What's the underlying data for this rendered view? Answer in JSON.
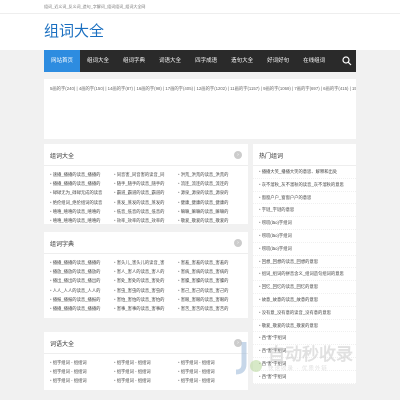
{
  "topline": "组词_近义词_反义词_造句_字解词_组词组词_组词大全网",
  "site_title": "组词大全",
  "nav": {
    "items": [
      "网站首页",
      "组词大全",
      "组词字典",
      "词语大全",
      "四字成语",
      "造句大全",
      "好词好句",
      "在线组词"
    ],
    "active_index": 0
  },
  "counts": [
    "5画的字(240)",
    "4画的字(150)",
    "14画的字(87)",
    "16画的字(98)",
    "17画的字(405)",
    "12画的字(1202)",
    "11画的字(1157)",
    "9画的字(1069)",
    "7画的字(697)",
    "6画的字(415)",
    "15画的字(525)",
    "13画的字(1024)",
    "10画的字(1129)",
    "8画的字(915)",
    "拼音(376)",
    "部首(1724)",
    "近义词(716)",
    "反义词(410)",
    "造句(767)",
    "词语(649)",
    "成语(3529)",
    "诗句(412)",
    "字谜(217)",
    "组词(11400)"
  ],
  "main_panels": [
    {
      "title": "组词大全",
      "cols": [
        [
          "速播_播播的读音_播播的",
          "播播_播播的读音_播播的",
          "碌碌无为_碌碌无成的读音",
          "绝伦组词_绝伦组词的读音",
          "嘻嘻_嘻嘻的读音_嘻嘻的",
          "嘻嘻_嘻嘻的读音_嘻嘻的"
        ],
        [
          "同音害_同音害的读音_同",
          "随手_随手的读音_随手的",
          "霸道_霸道的读音_霸道的",
          "蒸发_蒸发的读音_蒸发的",
          "低音_低音的读音_低音的",
          "效率_效率的读音_效率的"
        ],
        [
          "洪荒_洪荒的读音_洪荒的",
          "流连_流连的读音_流连的",
          "源泉_源泉的读音_源泉的",
          "健康_健康的读音_健康的",
          "嘛嘛_嘛嘛的读音_嘛嘛的",
          "敬爱_敬爱的读音_敬爱的"
        ]
      ]
    },
    {
      "title": "组词字典",
      "cols": [
        [
          "播播_播播的读音_播播的",
          "播放_播放的读音_播放的",
          "播出_播出的读音_播出的",
          "人人_人人的读音_人人的",
          "播报_播报的读音_播报的",
          "播播_播播的读音_播播的"
        ],
        [
          "害头儿_害头儿的读音_害",
          "害人_害人的读音_害人的",
          "害处_害处的读音_害处的",
          "害虫_害虫的读音_害虫的",
          "害怕_害怕的读音_害怕的",
          "害事_害事的读音_害事的"
        ],
        [
          "害羞_害羞的读音_害羞的",
          "害病_害病的读音_害病的",
          "害臊_害臊的读音_害臊的",
          "害己_害己的读音_害己的",
          "害眼_害眼的读音_害眼的",
          "害苦_害苦的读音_害苦的"
        ]
      ]
    },
    {
      "title": "词语大全",
      "cols": [
        [
          "组字组词 - 组组词",
          "组字组词 - 组组词",
          "组字组词 - 组组词"
        ],
        [
          "组字组词 - 组组词",
          "组字组词 - 组组词",
          "组字组词 - 组组词"
        ],
        [
          "组字组词 - 组组词",
          "组字组词 - 组组词",
          "组字组词 - 组组词"
        ]
      ]
    }
  ],
  "side": {
    "title": "热门组词",
    "items": [
      "播播大笑_播播大笑的意思、解释和出处",
      "灰不溜秋_灰不溜秋的读音_灰不溜秋的意思",
      "窗窗户户_窗窗户户的意思",
      "字谜_字谜的意思",
      "唠叨(lāo)字组词",
      "唠叨(lāo)字组词",
      "唠叨(lāo)字组词",
      "回想_回想的读音_回想的意思",
      "组词_组词的拼音含义_组词造句组词的意思",
      "回忆_回忆的读音_回忆的意思",
      "故意_故意的读音_故意的意思",
      "没有意_没有意的读音_没有意的意思",
      "敬爱_敬爱的读音_敬爱的意思",
      "西\"害\"字组词",
      "西\"害\"字组词",
      "西\"害\"字组词",
      "西\"害\"字组词"
    ]
  },
  "watermark": {
    "text": "自动秒收录",
    "sub": "快速收录 · 优质外链"
  }
}
